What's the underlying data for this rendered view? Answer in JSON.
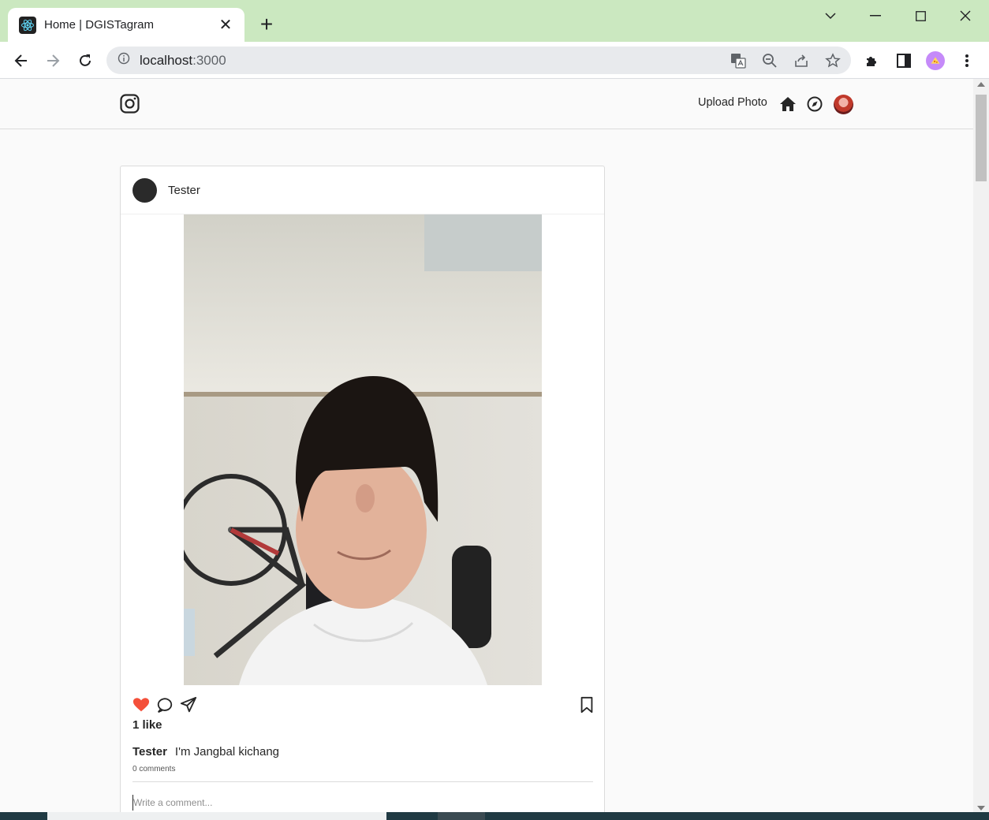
{
  "browser": {
    "tab_title": "Home | DGISTagram",
    "new_tab_symbol": "+",
    "close_tab_symbol": "✕",
    "url_host": "localhost",
    "url_port": ":3000"
  },
  "header": {
    "upload_label": "Upload Photo"
  },
  "post": {
    "username": "Tester",
    "likes_text": "1 like",
    "caption_user": "Tester",
    "caption_text": "I'm Jangbal kichang",
    "comments_count": "0 comments",
    "comment_placeholder": "Write a comment...",
    "liked": true
  },
  "colors": {
    "tab_strip": "#cbe8c0",
    "like_red": "#ed4956",
    "page_bg": "#fafafa",
    "border": "#dbdbdb"
  },
  "icons": {
    "logo": "instagram-icon",
    "home": "home-icon",
    "explore": "compass-icon",
    "like": "heart-icon",
    "comment": "comment-icon",
    "share": "send-icon",
    "save": "bookmark-icon"
  }
}
